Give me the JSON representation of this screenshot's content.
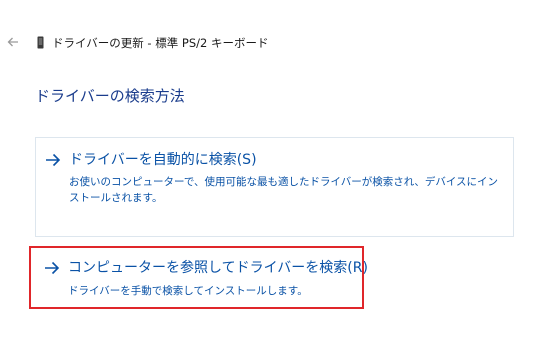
{
  "window": {
    "title": "ドライバーの更新 - 標準 PS/2 キーボード",
    "back_icon": "back-arrow-icon",
    "device_icon": "keyboard-device-icon"
  },
  "heading": "ドライバーの検索方法",
  "options": [
    {
      "title": "ドライバーを自動的に検索(S)",
      "description": "お使いのコンピューターで、使用可能な最も適したドライバーが検索され、デバイスにインストールされます。",
      "icon": "arrow-right-icon"
    },
    {
      "title": "コンピューターを参照してドライバーを検索(R)",
      "description": "ドライバーを手動で検索してインストールします。",
      "icon": "arrow-right-icon",
      "highlight_color": "#e0262a"
    }
  ],
  "colors": {
    "link": "#0a52a6",
    "heading": "#1a3c8c",
    "highlight": "#e0262a"
  }
}
